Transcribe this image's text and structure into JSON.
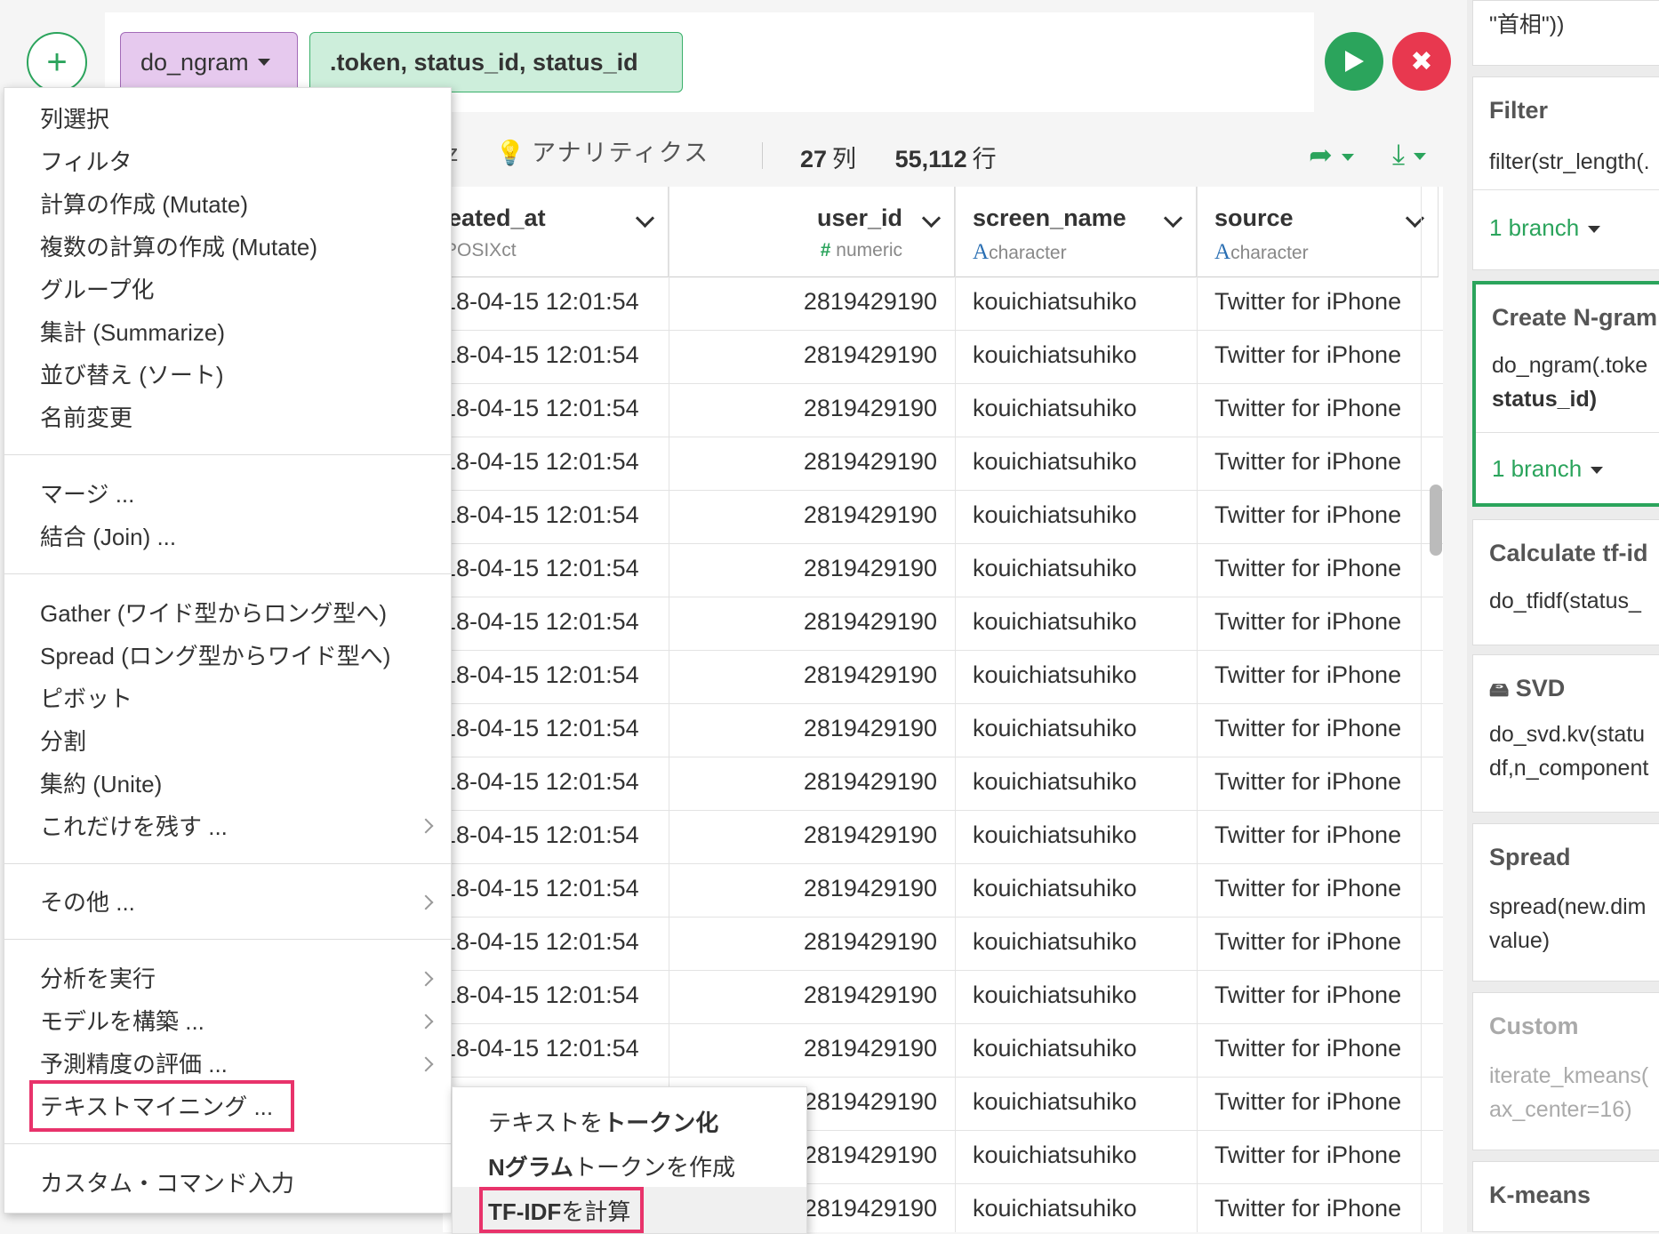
{
  "command": {
    "function": "do_ngram",
    "args": ".token, status_id, status_id"
  },
  "toolbar": {
    "analytics": "アナリティクス",
    "partial_left": "z",
    "cols_count": "27",
    "cols_label": "列",
    "rows_count": "55,112",
    "rows_label": "行"
  },
  "columns": [
    {
      "name": "eated_at",
      "type": "POSIXct"
    },
    {
      "name": "user_id",
      "type": "numeric"
    },
    {
      "name": "screen_name",
      "type": "character"
    },
    {
      "name": "source",
      "type": "character"
    }
  ],
  "rows": [
    {
      "created_at": "18-04-15 12:01:54",
      "user_id": "2819429190",
      "screen_name": "kouichiatsuhiko",
      "source": "Twitter for iPhone"
    },
    {
      "created_at": "18-04-15 12:01:54",
      "user_id": "2819429190",
      "screen_name": "kouichiatsuhiko",
      "source": "Twitter for iPhone"
    },
    {
      "created_at": "18-04-15 12:01:54",
      "user_id": "2819429190",
      "screen_name": "kouichiatsuhiko",
      "source": "Twitter for iPhone"
    },
    {
      "created_at": "18-04-15 12:01:54",
      "user_id": "2819429190",
      "screen_name": "kouichiatsuhiko",
      "source": "Twitter for iPhone"
    },
    {
      "created_at": "18-04-15 12:01:54",
      "user_id": "2819429190",
      "screen_name": "kouichiatsuhiko",
      "source": "Twitter for iPhone"
    },
    {
      "created_at": "18-04-15 12:01:54",
      "user_id": "2819429190",
      "screen_name": "kouichiatsuhiko",
      "source": "Twitter for iPhone"
    },
    {
      "created_at": "18-04-15 12:01:54",
      "user_id": "2819429190",
      "screen_name": "kouichiatsuhiko",
      "source": "Twitter for iPhone"
    },
    {
      "created_at": "18-04-15 12:01:54",
      "user_id": "2819429190",
      "screen_name": "kouichiatsuhiko",
      "source": "Twitter for iPhone"
    },
    {
      "created_at": "18-04-15 12:01:54",
      "user_id": "2819429190",
      "screen_name": "kouichiatsuhiko",
      "source": "Twitter for iPhone"
    },
    {
      "created_at": "18-04-15 12:01:54",
      "user_id": "2819429190",
      "screen_name": "kouichiatsuhiko",
      "source": "Twitter for iPhone"
    },
    {
      "created_at": "18-04-15 12:01:54",
      "user_id": "2819429190",
      "screen_name": "kouichiatsuhiko",
      "source": "Twitter for iPhone"
    },
    {
      "created_at": "18-04-15 12:01:54",
      "user_id": "2819429190",
      "screen_name": "kouichiatsuhiko",
      "source": "Twitter for iPhone"
    },
    {
      "created_at": "18-04-15 12:01:54",
      "user_id": "2819429190",
      "screen_name": "kouichiatsuhiko",
      "source": "Twitter for iPhone"
    },
    {
      "created_at": "18-04-15 12:01:54",
      "user_id": "2819429190",
      "screen_name": "kouichiatsuhiko",
      "source": "Twitter for iPhone"
    },
    {
      "created_at": "18-04-15 12:01:54",
      "user_id": "2819429190",
      "screen_name": "kouichiatsuhiko",
      "source": "Twitter for iPhone"
    },
    {
      "created_at": "",
      "user_id": "2819429190",
      "screen_name": "kouichiatsuhiko",
      "source": "Twitter for iPhone"
    },
    {
      "created_at": "",
      "user_id": "2819429190",
      "screen_name": "kouichiatsuhiko",
      "source": "Twitter for iPhone"
    },
    {
      "created_at": "",
      "user_id": "2819429190",
      "screen_name": "kouichiatsuhiko",
      "source": "Twitter for iPhone"
    }
  ],
  "menu": {
    "items": [
      {
        "label": "列選択"
      },
      {
        "label": "フィルタ"
      },
      {
        "label": "計算の作成 (Mutate)"
      },
      {
        "label": "複数の計算の作成 (Mutate)"
      },
      {
        "label": "グループ化"
      },
      {
        "label": "集計 (Summarize)"
      },
      {
        "label": "並び替え (ソート)"
      },
      {
        "label": "名前変更"
      },
      {
        "label": "マージ ..."
      },
      {
        "label": "結合 (Join) ..."
      },
      {
        "label": "Gather (ワイド型からロング型へ)"
      },
      {
        "label": "Spread (ロング型からワイド型へ)"
      },
      {
        "label": "ピボット"
      },
      {
        "label": "分割"
      },
      {
        "label": "集約 (Unite)"
      },
      {
        "label": "これだけを残す ..."
      },
      {
        "label": "その他 ..."
      },
      {
        "label": "分析を実行"
      },
      {
        "label": "モデルを構築 ..."
      },
      {
        "label": "予測精度の評価 ..."
      },
      {
        "label": "テキストマイニング ..."
      },
      {
        "label": "カスタム・コマンド入力"
      }
    ]
  },
  "submenu": {
    "tokenize_prefix": "テキストを",
    "tokenize_bold": "トークン化",
    "ngram_bold": "Nグラム",
    "ngram_suffix": "トークンを作成",
    "tfidf_bold": "TF-IDF",
    "tfidf_suffix": "を計算"
  },
  "steps": [
    {
      "title": "",
      "body": [
        "\"首相\"))"
      ],
      "branch": ""
    },
    {
      "title": "Filter",
      "body": [
        "filter(str_length(."
      ],
      "branch": "1 branch"
    },
    {
      "title": "Create N-gram",
      "body": [
        "do_ngram(.toke",
        "status_id)"
      ],
      "branch": "1 branch"
    },
    {
      "title": "Calculate tf-id",
      "body": [
        "do_tfidf(status_"
      ],
      "branch": ""
    },
    {
      "title": "SVD",
      "body": [
        "do_svd.kv(statu",
        "df,n_component"
      ],
      "branch": ""
    },
    {
      "title": "Spread",
      "body": [
        "spread(new.dim",
        "value)"
      ],
      "branch": ""
    },
    {
      "title": "Custom",
      "body": [
        "iterate_kmeans(",
        "ax_center=16)"
      ],
      "branch": ""
    },
    {
      "title": "K-means",
      "body": [],
      "branch": ""
    }
  ]
}
